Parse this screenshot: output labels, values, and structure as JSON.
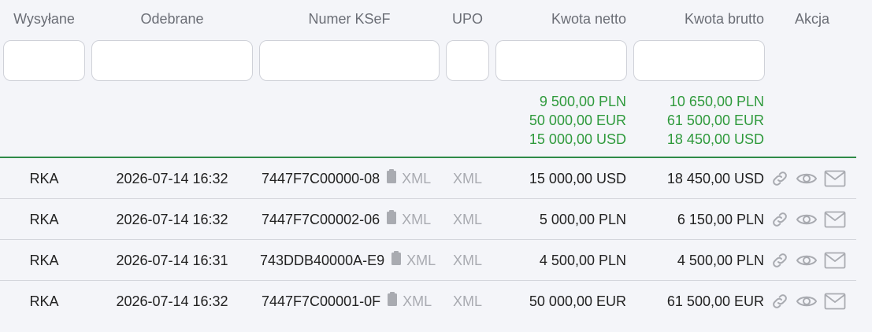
{
  "headers": {
    "sent": "Wysyłane",
    "received": "Odebrane",
    "ksef": "Numer KSeF",
    "upo": "UPO",
    "net": "Kwota netto",
    "gross": "Kwota brutto",
    "action": "Akcja"
  },
  "totals": {
    "net": [
      "9 500,00 PLN",
      "50 000,00 EUR",
      "15 000,00 USD"
    ],
    "gross": [
      "10 650,00 PLN",
      "61 500,00 EUR",
      "18 450,00 USD"
    ]
  },
  "rows": [
    {
      "sent": "RKA",
      "received": "2026-07-14 16:32",
      "ksef": "7447F7C00000-08",
      "xml": "XML",
      "upo": "XML",
      "net": "15 000,00 USD",
      "gross": "18 450,00 USD"
    },
    {
      "sent": "RKA",
      "received": "2026-07-14 16:32",
      "ksef": "7447F7C00002-06",
      "xml": "XML",
      "upo": "XML",
      "net": "5 000,00 PLN",
      "gross": "6 150,00 PLN"
    },
    {
      "sent": "RKA",
      "received": "2026-07-14 16:31",
      "ksef": "743DDB40000A-E9",
      "xml": "XML",
      "upo": "XML",
      "net": "4 500,00 PLN",
      "gross": "4 500,00 PLN"
    },
    {
      "sent": "RKA",
      "received": "2026-07-14 16:32",
      "ksef": "7447F7C00001-0F",
      "xml": "XML",
      "upo": "XML",
      "net": "50 000,00 EUR",
      "gross": "61 500,00 EUR"
    }
  ],
  "icons": {
    "copy": "clipboard-icon",
    "link": "link-icon",
    "view": "eye-icon",
    "mail": "envelope-icon"
  },
  "colors": {
    "accent_green": "#2f9a3c",
    "muted": "#a9abb1"
  }
}
